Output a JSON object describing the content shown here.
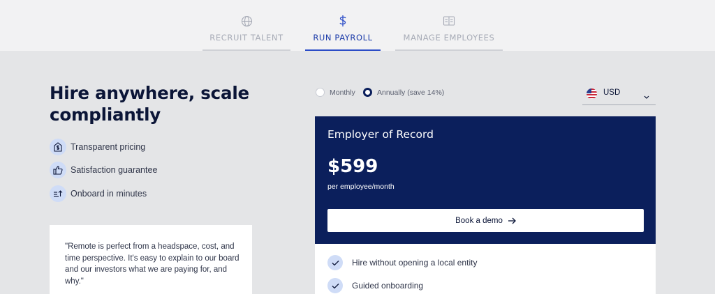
{
  "tabs": [
    {
      "label": "RECRUIT TALENT",
      "icon": "globe-icon",
      "active": false
    },
    {
      "label": "RUN PAYROLL",
      "icon": "dollar-icon",
      "active": true
    },
    {
      "label": "MANAGE EMPLOYEES",
      "icon": "id-card-icon",
      "active": false
    }
  ],
  "hero": {
    "headline_line1": "Hire anywhere, scale",
    "headline_line2": "compliantly"
  },
  "features": [
    {
      "label": "Transparent pricing",
      "icon": "price-tag-icon"
    },
    {
      "label": "Satisfaction guarantee",
      "icon": "thumbs-up-icon"
    },
    {
      "label": "Onboard in minutes",
      "icon": "list-arrow-up-icon"
    }
  ],
  "quote": {
    "text": "\"Remote is perfect from a headspace, cost, and time perspective. It's easy to explain to our board and our investors what we are paying for, and why.\""
  },
  "billing": {
    "monthly_label": "Monthly",
    "annually_label": "Annually (save 14%)",
    "selected": "annually"
  },
  "currency": {
    "selected": "USD",
    "flag": "us-flag-icon"
  },
  "plan": {
    "title": "Employer of Record",
    "price": "$599",
    "price_unit": "per employee/month",
    "cta_label": "Book a demo",
    "features": [
      {
        "label": "Hire without opening a local entity"
      },
      {
        "label": "Guided onboarding"
      }
    ]
  },
  "colors": {
    "navy": "#0b1f5c",
    "accent_blue": "#2b4cc7",
    "icon_bg": "#cfdcf7",
    "page_bg": "#e4e5e7"
  }
}
